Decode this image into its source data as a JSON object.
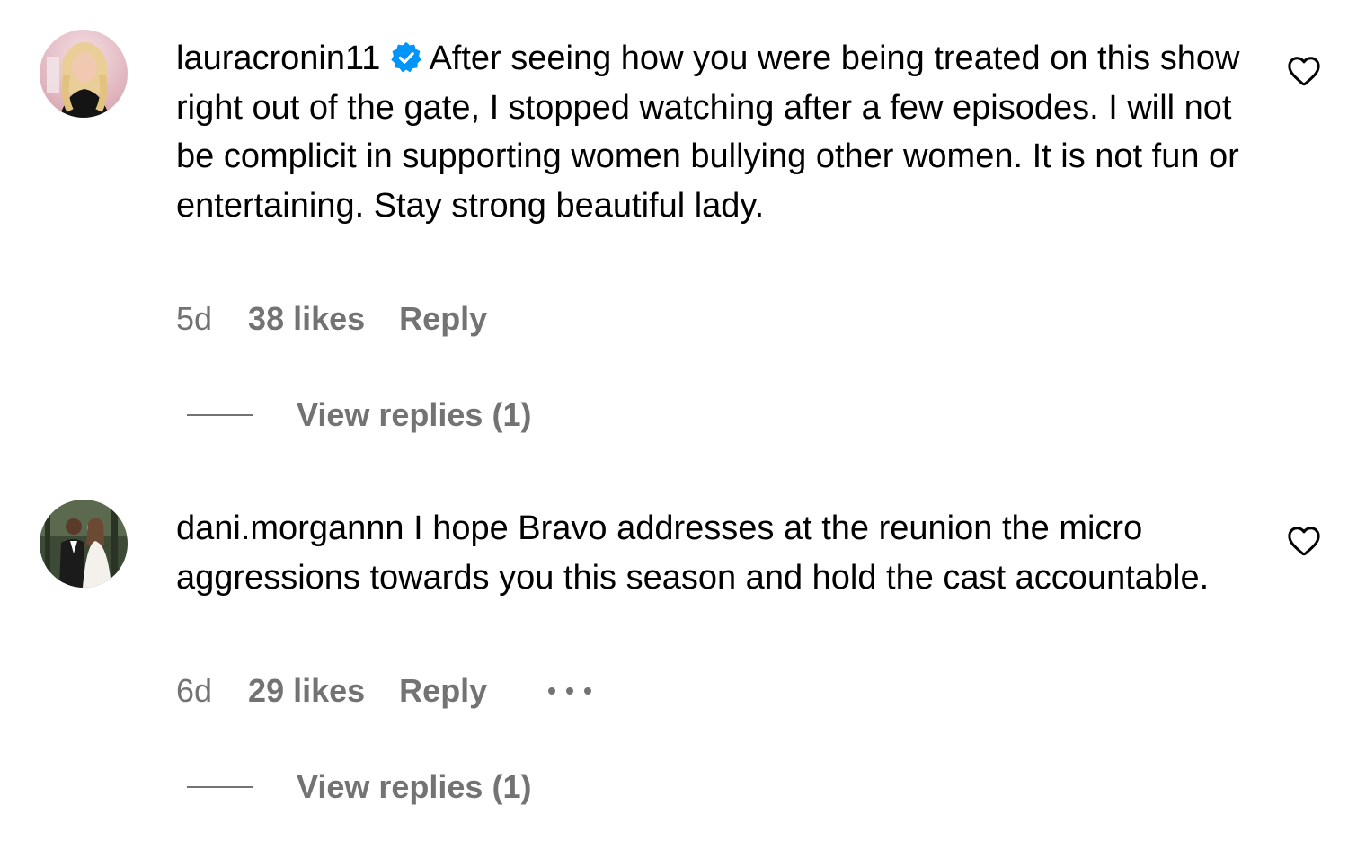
{
  "comments": [
    {
      "username": "lauracronin11",
      "verified": true,
      "text": "After seeing how you were being treated on this show right out of the gate, I stopped watching after a few episodes. I will not be complicit in supporting women bullying other women. It is not fun or entertaining. Stay strong beautiful lady.",
      "time": "5d",
      "likes": "38 likes",
      "reply_label": "Reply",
      "view_replies": "View replies (1)",
      "like_icon": "heart-outline-icon"
    },
    {
      "username": "dani.morgannn",
      "verified": false,
      "text": "I hope Bravo addresses at the reunion the micro aggressions towards you this season and hold the cast accountable.",
      "time": "6d",
      "likes": "29 likes",
      "reply_label": "Reply",
      "more_icon": "more-options-icon",
      "view_replies": "View replies (1)",
      "like_icon": "heart-outline-icon"
    }
  ],
  "colors": {
    "text": "#000000",
    "secondary": "#737373",
    "verified_badge": "#0095F6",
    "background": "#ffffff"
  }
}
